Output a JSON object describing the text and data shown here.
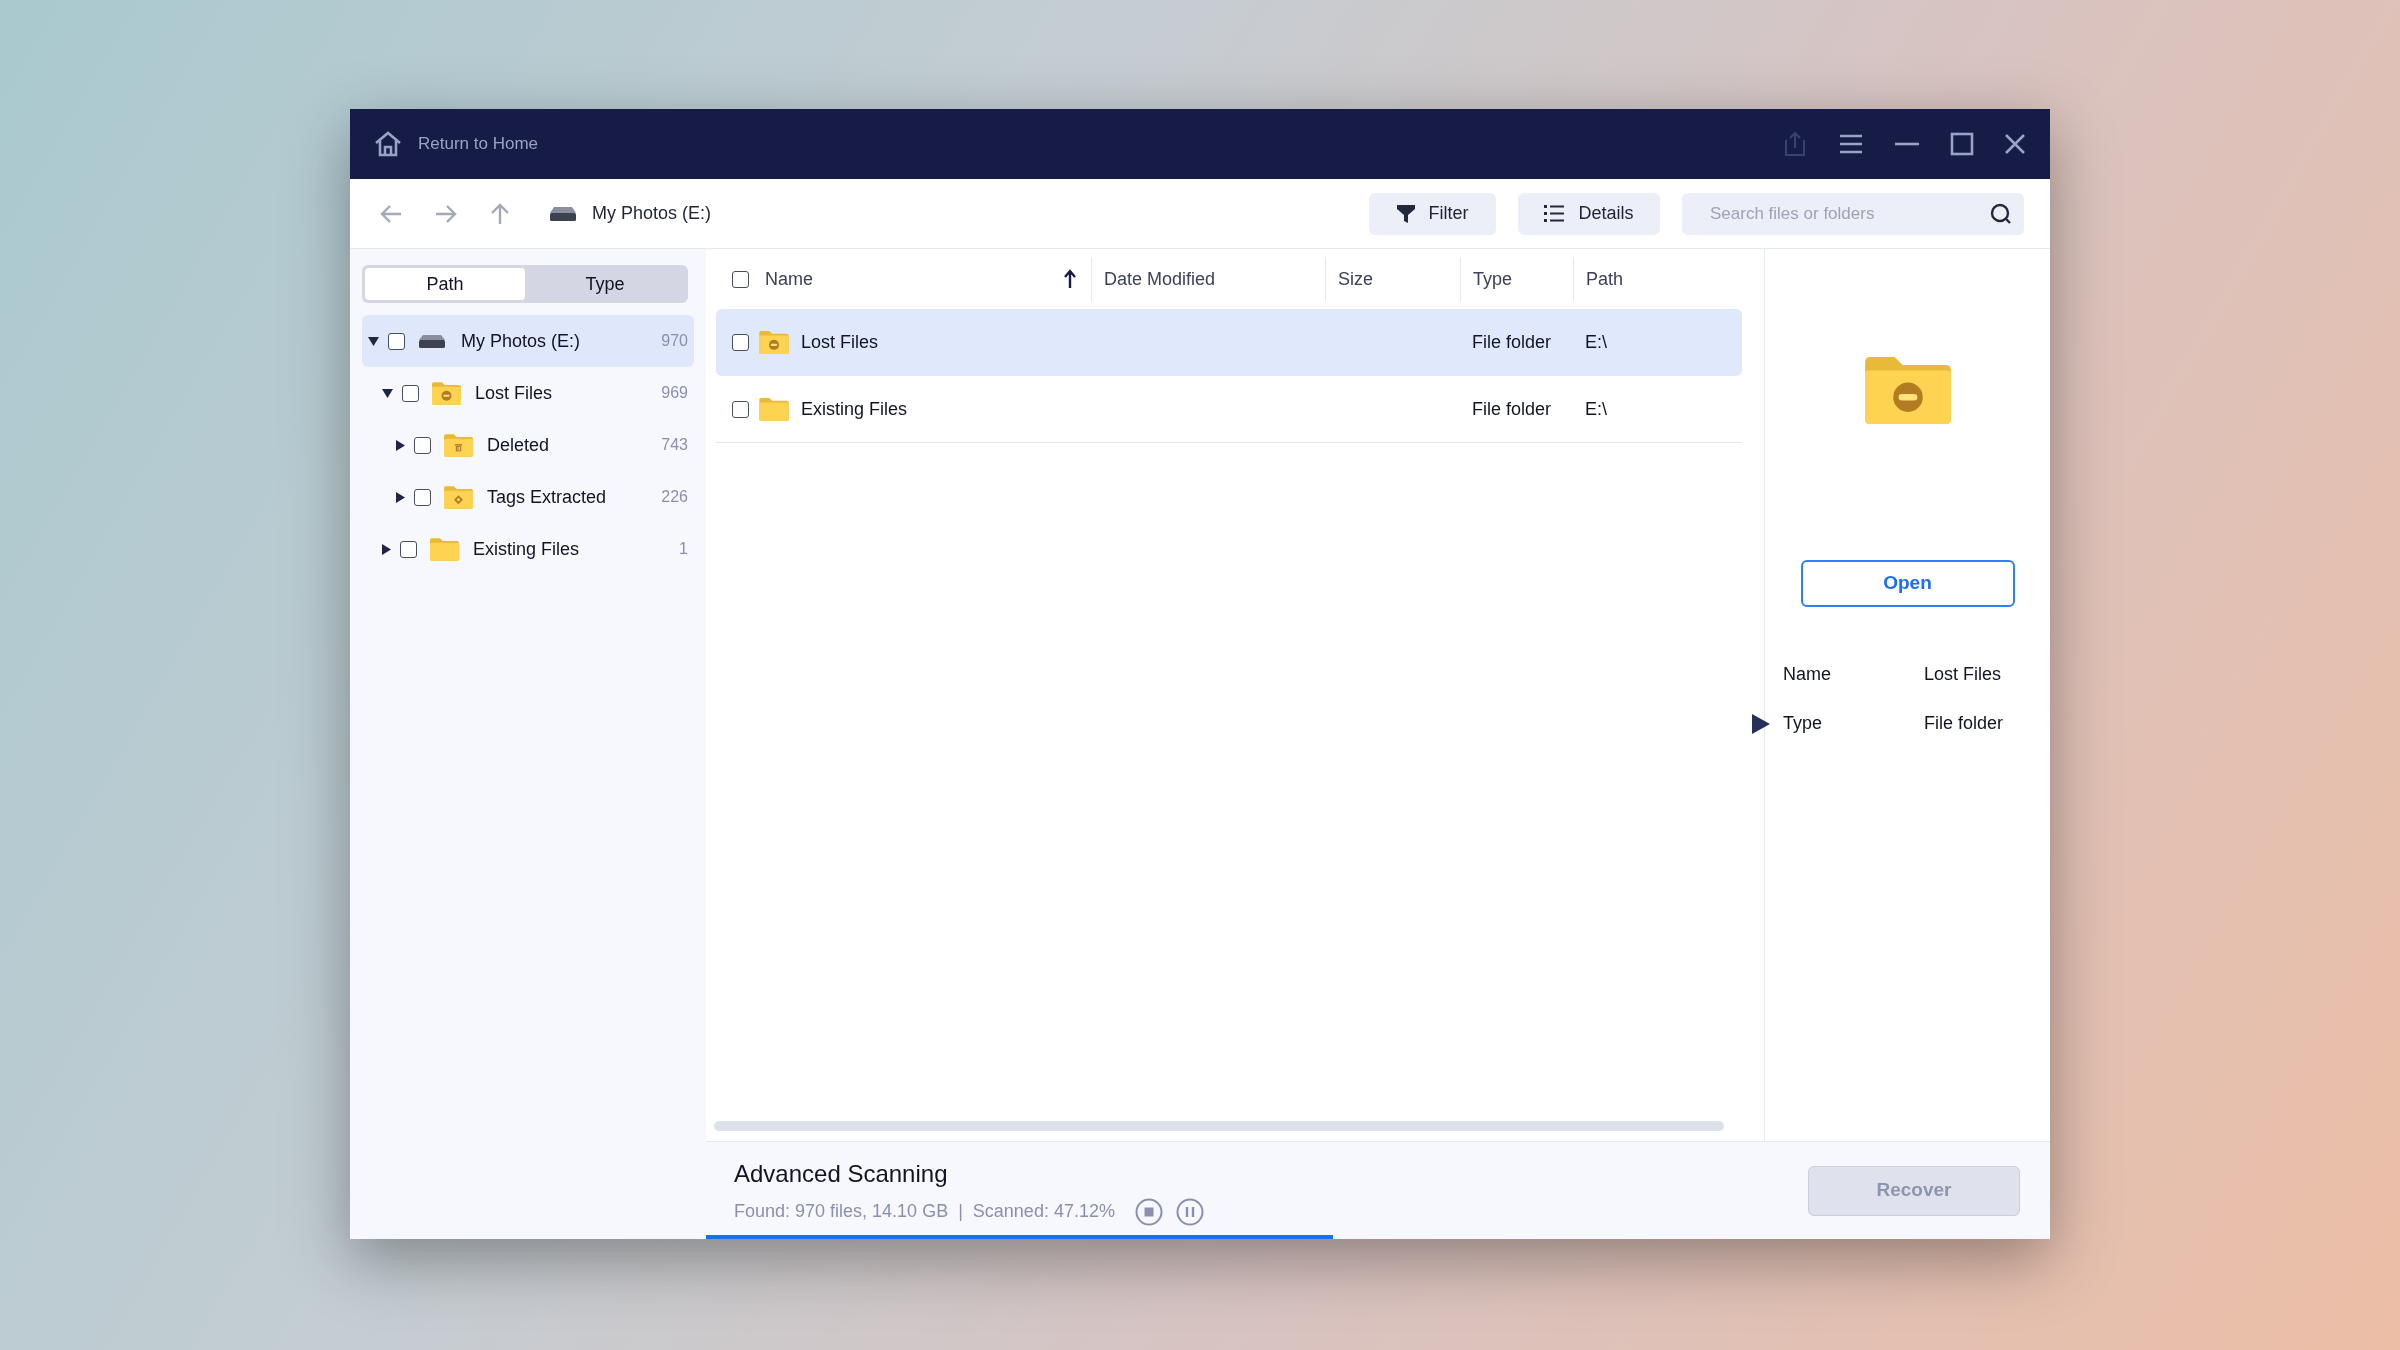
{
  "window": {
    "title": "Return to Home"
  },
  "toolbar": {
    "location": "My Photos (E:)",
    "buttons": [
      {
        "label": "Filter",
        "kind": "filter"
      },
      {
        "label": "Details",
        "kind": "details"
      }
    ],
    "search": {
      "placeholder": "Search files or folders"
    }
  },
  "sidebar": {
    "tabs": [
      {
        "label": "Path",
        "selected": true
      },
      {
        "label": "Type",
        "selected": false
      }
    ],
    "tree": [
      {
        "label": "My Photos (E:)",
        "count": "970",
        "kind": "drive",
        "expanded": true,
        "checked": false,
        "selected": true,
        "children": [
          {
            "label": "Lost Files",
            "count": "969",
            "kind": "lost",
            "expanded": true,
            "checked": false,
            "selected": false,
            "children": [
              {
                "label": "Deleted",
                "count": "743",
                "kind": "deleted",
                "expanded": false,
                "checked": false,
                "selected": false
              },
              {
                "label": "Tags Extracted",
                "count": "226",
                "kind": "tags",
                "expanded": false,
                "checked": false,
                "selected": false
              }
            ]
          },
          {
            "label": "Existing Files",
            "count": "1",
            "kind": "folder",
            "expanded": false,
            "checked": false,
            "selected": false
          }
        ]
      }
    ]
  },
  "table": {
    "all_checked": false,
    "columns": [
      {
        "label": "Name",
        "sorted": true
      },
      {
        "label": "Date Modified",
        "sorted": false
      },
      {
        "label": "Size",
        "sorted": false
      },
      {
        "label": "Type",
        "sorted": false
      },
      {
        "label": "Path",
        "sorted": false
      }
    ],
    "rows": [
      {
        "name": "Lost Files",
        "kind": "lost",
        "type": "File folder",
        "path": "E:\\",
        "checked": false,
        "selected": true
      },
      {
        "name": "Existing Files",
        "kind": "folder",
        "type": "File folder",
        "path": "E:\\",
        "checked": false,
        "selected": false
      }
    ]
  },
  "details": {
    "kind": "lost",
    "button": "Open",
    "fields": [
      {
        "label": "Name",
        "value": "Lost Files"
      },
      {
        "label": "Type",
        "value": "File folder"
      }
    ]
  },
  "scan": {
    "title": "Advanced Scanning",
    "found": "Found: 970 files, 14.10 GB",
    "separator": "|",
    "scanned": "Scanned: 47.12%",
    "level": 0.4712
  },
  "recover_button": {
    "label": "Recover",
    "disabled": true
  }
}
